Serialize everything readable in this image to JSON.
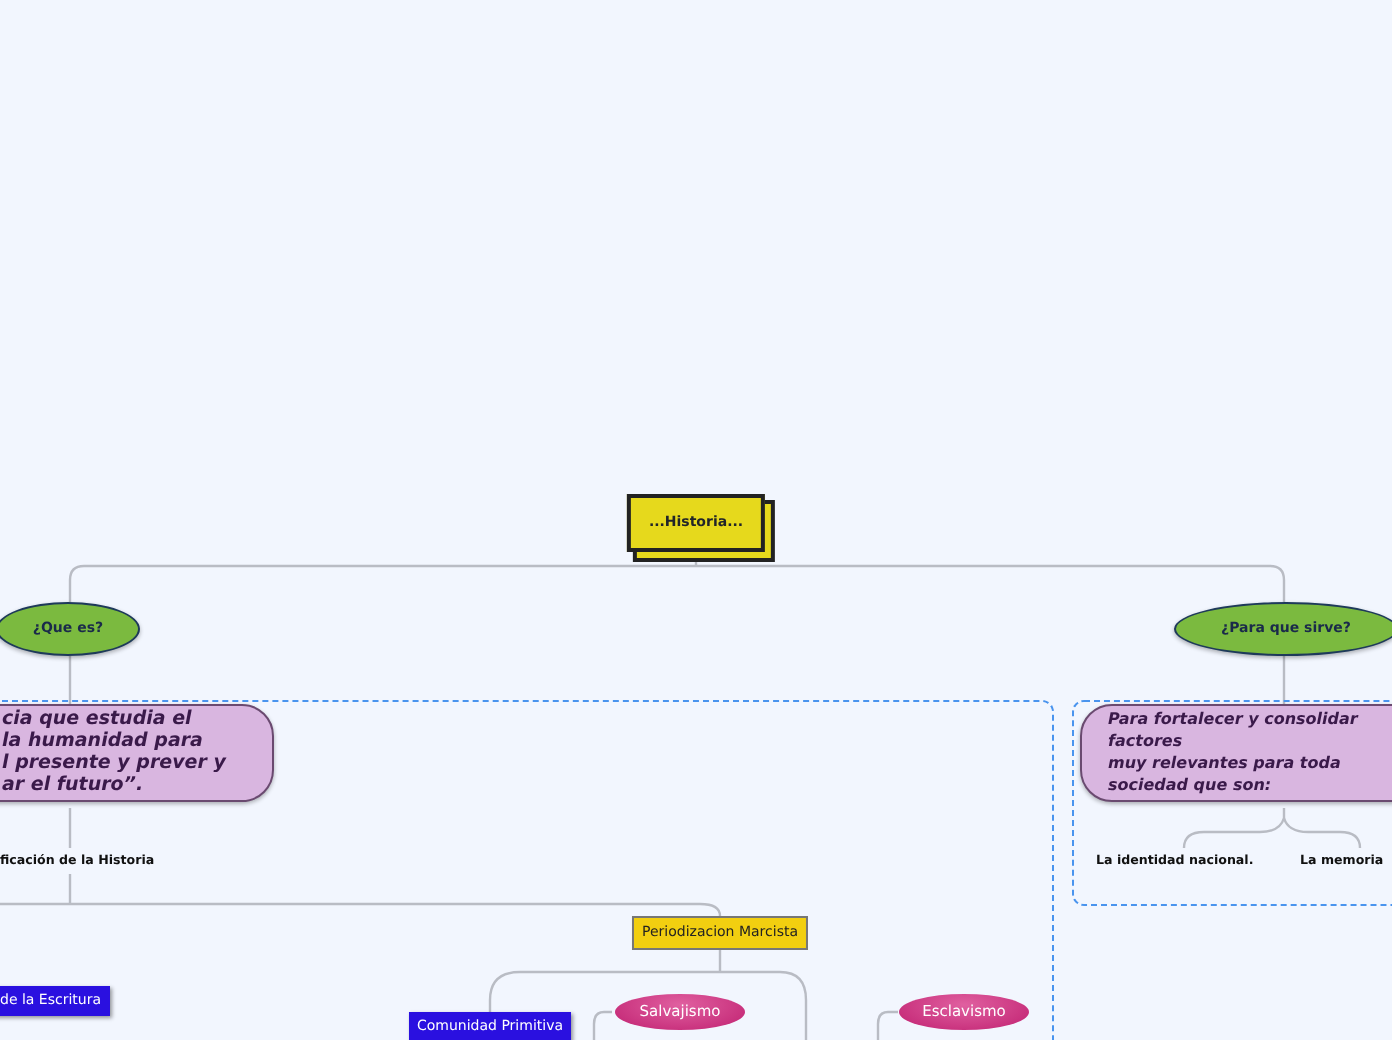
{
  "nodes": [
    {
      "kind": "root",
      "label": "...Historia..."
    },
    {
      "kind": "question",
      "label": "¿Que es?"
    },
    {
      "kind": "question",
      "label": "¿Para que sirve?"
    },
    {
      "kind": "note",
      "label": "cia que estudia el\nla humanidad para\nl presente y prever y\nar el futuro”."
    },
    {
      "kind": "note",
      "label": "Para fortalecer y consolidar\nfactores\nmuy relevantes para toda\nsociedad que son:"
    },
    {
      "kind": "label",
      "label": "ficación de la Historia"
    },
    {
      "kind": "label",
      "label": "La identidad nacional."
    },
    {
      "kind": "label",
      "label": "La memoria"
    },
    {
      "kind": "period",
      "label": "Periodizacion Marcista"
    },
    {
      "kind": "era",
      "label": "de la Escritura"
    },
    {
      "kind": "stage",
      "label": "Salvajismo"
    },
    {
      "kind": "stage",
      "label": "Esclavismo"
    },
    {
      "kind": "era",
      "label": "Comunidad Primitiva"
    }
  ]
}
